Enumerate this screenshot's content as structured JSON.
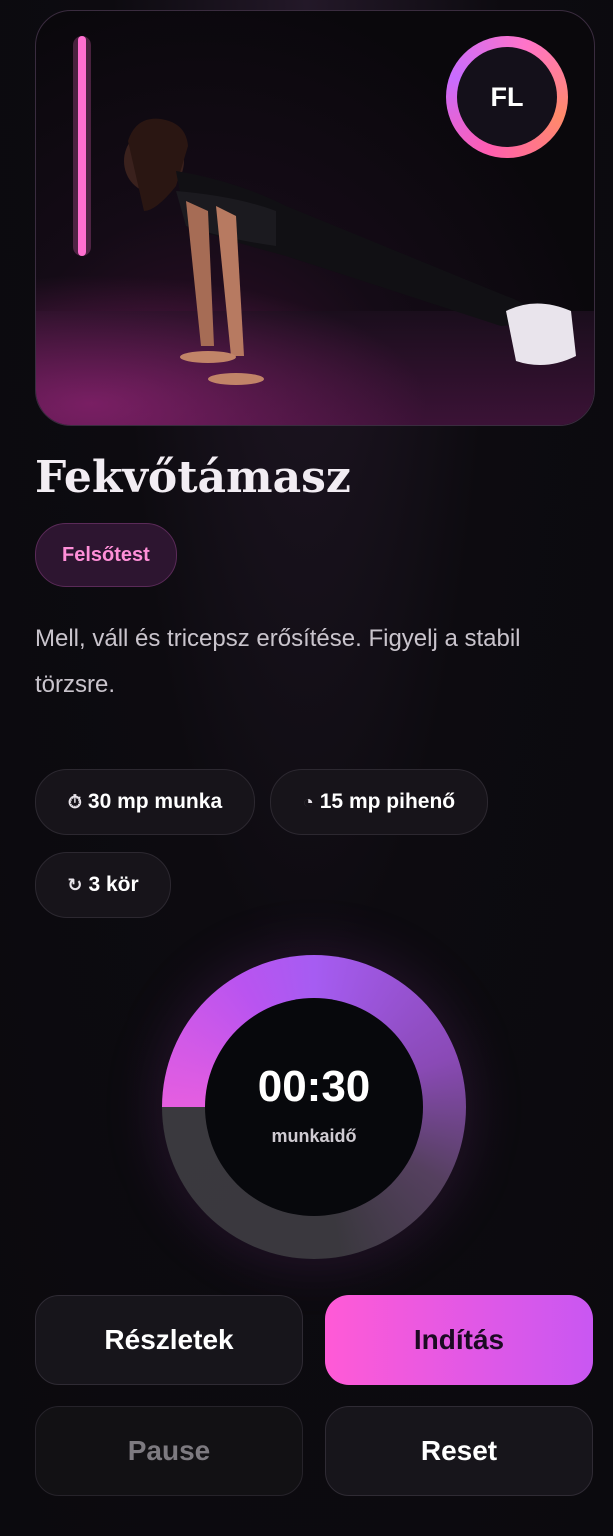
{
  "avatar": {
    "initials": "FL"
  },
  "exercise": {
    "title": "Fekvőtámasz",
    "category": "Felsőtest",
    "description": "Mell, váll és tricepsz erősítése. Figyelj a stabil törzsre."
  },
  "stats": {
    "work": {
      "icon": "stopwatch-icon",
      "glyph": "⏱",
      "label": "30 mp munka"
    },
    "rest": {
      "icon": "clock-icon",
      "glyph": "◔",
      "label": "15 mp pihenő"
    },
    "rounds": {
      "icon": "repeat-icon",
      "glyph": "↻",
      "label": "3 kör"
    }
  },
  "timer": {
    "time": "00:30",
    "label": "munkaidő",
    "progress_fraction": 0.75
  },
  "buttons": {
    "details": "Részletek",
    "start": "Indítás",
    "pause": "Pause",
    "reset": "Reset"
  },
  "colors": {
    "accent_pink": "#ff5ad6",
    "accent_purple": "#c957f2",
    "background": "#0c0a10"
  }
}
